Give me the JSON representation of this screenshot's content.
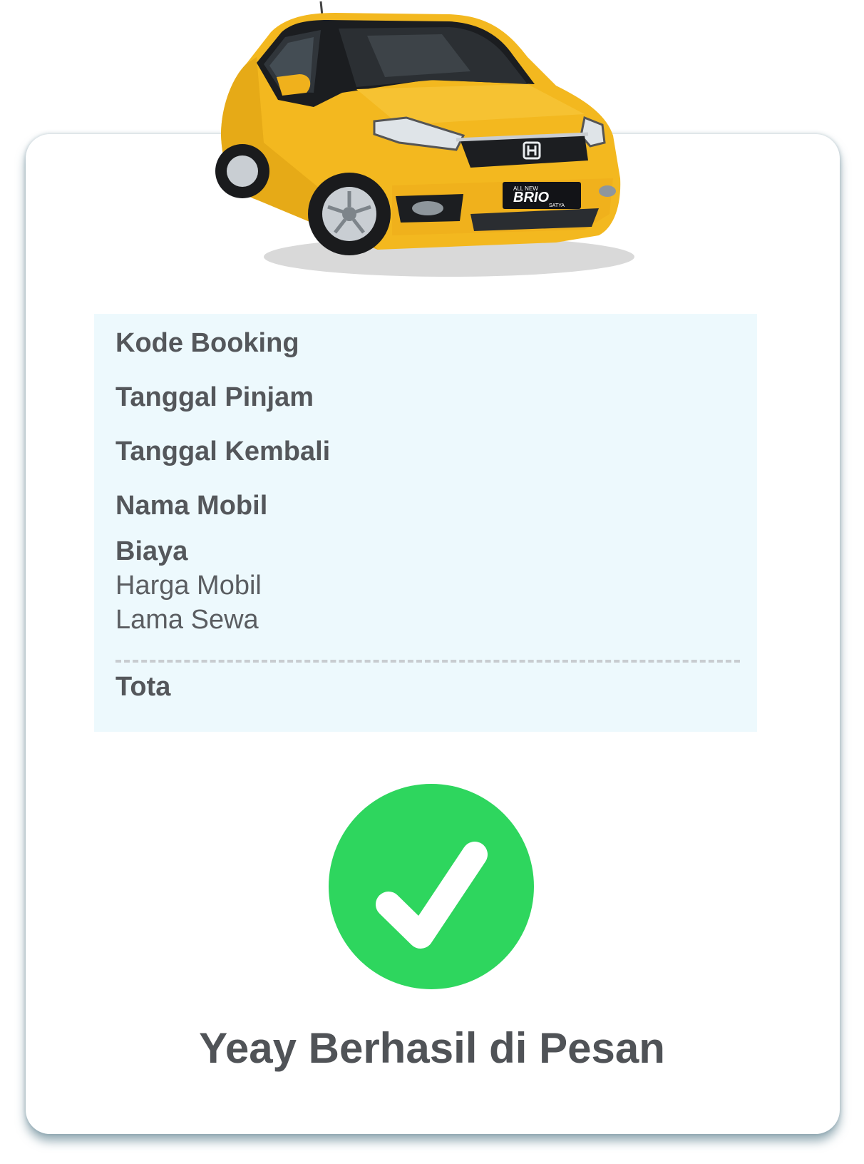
{
  "car": {
    "badge_top": "ALL NEW",
    "badge_main": "BRIO",
    "badge_sub": "SATYA"
  },
  "details": {
    "kode_booking": "Kode Booking",
    "tanggal_pinjam": "Tanggal Pinjam",
    "tanggal_kembali": "Tanggal Kembali",
    "nama_mobil": "Nama Mobil",
    "biaya": "Biaya",
    "harga_mobil": "Harga Mobil",
    "lama_sewa": "Lama Sewa",
    "total": "Tota"
  },
  "status": {
    "message": "Yeay Berhasil di Pesan",
    "success_color": "#2ed65e",
    "icon": "check-icon"
  },
  "colors": {
    "card_shadow": "#466e7d",
    "details_bg": "#edf9fd",
    "car_body": "#f3b81f"
  }
}
